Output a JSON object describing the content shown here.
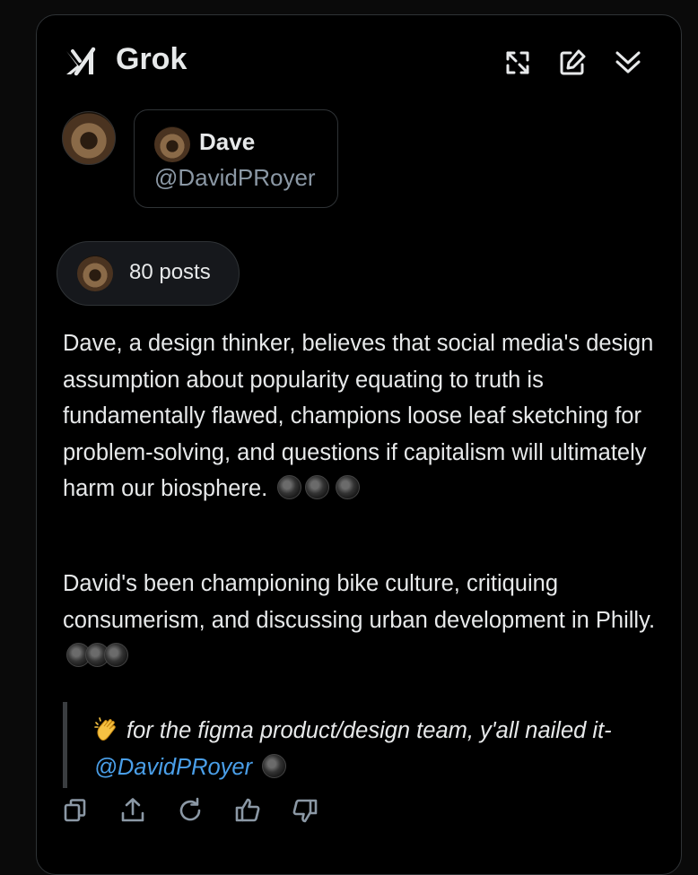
{
  "header": {
    "title": "Grok",
    "logo_icon": "xai-logo-icon",
    "icons": [
      "expand-icon",
      "new-chat-icon",
      "collapse-icon"
    ]
  },
  "user_card": {
    "name": "Dave",
    "handle": "@DavidPRoyer"
  },
  "posts": {
    "label": "80 posts"
  },
  "paragraphs": [
    "Dave, a design thinker, believes that social media's design assumption about popularity equating to truth is fundamentally flawed, champions loose leaf sketching for problem-solving, and questions if capitalism will ultimately harm our biosphere.",
    "David's been championing bike culture, critiquing consumerism, and discussing urban development in Philly."
  ],
  "quote": {
    "emoji_icon": "clapping-hands-icon",
    "text": "for the figma product/design team, y'all nailed it-",
    "mention": "@DavidPRoyer"
  },
  "actions": [
    "copy-icon",
    "share-icon",
    "regenerate-icon",
    "thumbs-up-icon",
    "thumbs-down-icon"
  ],
  "colors": {
    "background": "#000000",
    "text": "#e7e9ea",
    "muted": "#8b98a5",
    "link": "#4a9fe9",
    "border": "#2f3336"
  }
}
